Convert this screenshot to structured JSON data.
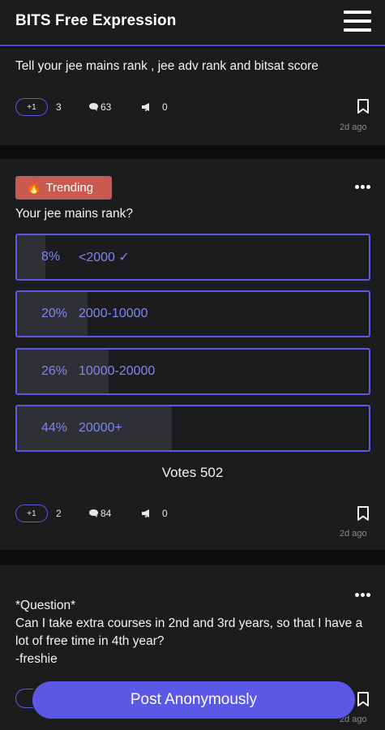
{
  "header": {
    "title": "BITS Free Expression",
    "menu_icon": "hamburger-menu-icon"
  },
  "posts": [
    {
      "text": "Tell your jee mains rank , jee adv rank and bitsat score",
      "plus_label": "+1",
      "upvotes": "3",
      "comments": "63",
      "shares": "0",
      "time": "2d ago"
    },
    {
      "badge": "Trending",
      "text": "Your jee mains rank?",
      "options": [
        {
          "percent": "8%",
          "label": "<2000 ✓",
          "fraction": 0.08
        },
        {
          "percent": "20%",
          "label": "2000-10000",
          "fraction": 0.2
        },
        {
          "percent": "26%",
          "label": "10000-20000",
          "fraction": 0.26
        },
        {
          "percent": "44%",
          "label": "20000+",
          "fraction": 0.44
        }
      ],
      "votes": "Votes 502",
      "plus_label": "+1",
      "upvotes": "2",
      "comments": "84",
      "shares": "0",
      "time": "2d ago"
    },
    {
      "text": "*Question*\nCan I take extra courses in 2nd and 3rd years, so that I have a lot of free time in 4th year?\n-freshie",
      "time": "2d ago"
    }
  ],
  "post_button": "Post Anonymously",
  "colors": {
    "accent": "#5b58e8",
    "trending": "#c85a50",
    "background": "#0d0d0f",
    "card": "#1c1c1f"
  }
}
